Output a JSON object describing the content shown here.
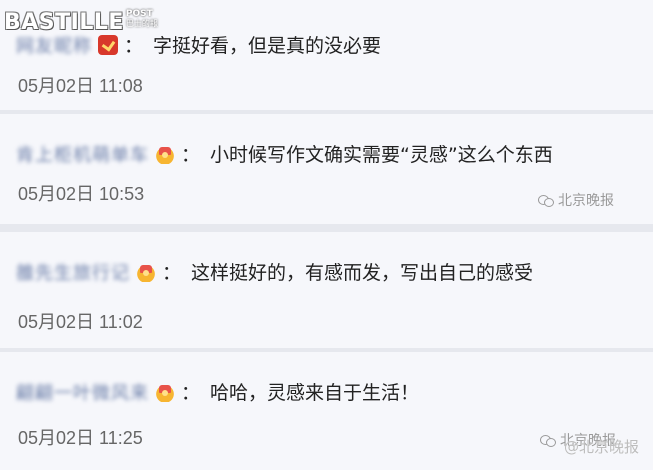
{
  "logo": {
    "main": "BASTILLE",
    "post": "POST",
    "sub": "巴士的報"
  },
  "comments": [
    {
      "username": "网友昵称",
      "text": "字挺好看，但是真的没必要",
      "time": "05月02日 11:08",
      "badge": "sq"
    },
    {
      "username": "肯上柜机萌单车",
      "text": "小时候写作文确实需要“灵感”这么个东西",
      "time": "05月02日 10:53",
      "badge": "crown"
    },
    {
      "username": "雒先生旅行记",
      "text": "这样挺好的，有感而发，写出自己的感受",
      "time": "05月02日 11:02",
      "badge": "crown"
    },
    {
      "username": "翩翩一叶微风来",
      "text": "哈哈，灵感来自于生活！",
      "time": "05月02日 11:25",
      "badge": "crown"
    }
  ],
  "colon": "：",
  "watermarks": {
    "inline1": "北京晚报",
    "inline2": "北京晚报",
    "overlay": "@北京晚报"
  }
}
